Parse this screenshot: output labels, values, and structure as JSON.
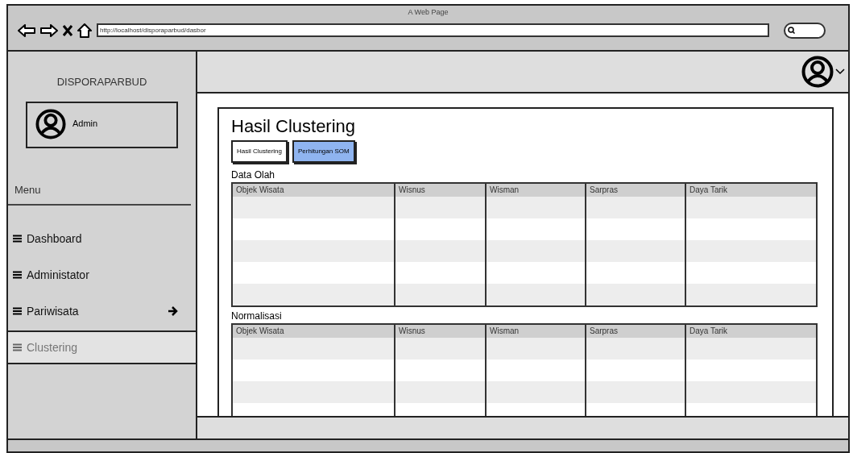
{
  "window": {
    "title": "A Web Page",
    "url": "http://localhost/disporaparbud/dasbor"
  },
  "sidebar": {
    "brand": "DISPORAPARBUD",
    "user": "Admin",
    "menu_heading": "Menu",
    "items": [
      {
        "label": "Dashboard",
        "selected": false,
        "arrow": false
      },
      {
        "label": "Administator",
        "selected": false,
        "arrow": false
      },
      {
        "label": "Pariwisata",
        "selected": false,
        "arrow": true
      },
      {
        "label": "Clustering",
        "selected": true,
        "arrow": false
      }
    ]
  },
  "page": {
    "title": "Hasil Clustering",
    "tabs": [
      {
        "label": "Hasil Clustering",
        "selected": false
      },
      {
        "label": "Perhitungan SOM",
        "selected": true
      }
    ],
    "tables": [
      {
        "title": "Data Olah",
        "columns": [
          "Objek Wisata",
          "Wisnus",
          "Wisman",
          "Sarpras",
          "Daya Tarik"
        ]
      },
      {
        "title": "Normalisasi",
        "columns": [
          "Objek Wisata",
          "Wisnus",
          "Wisman",
          "Sarpras",
          "Daya Tarik"
        ]
      }
    ]
  }
}
